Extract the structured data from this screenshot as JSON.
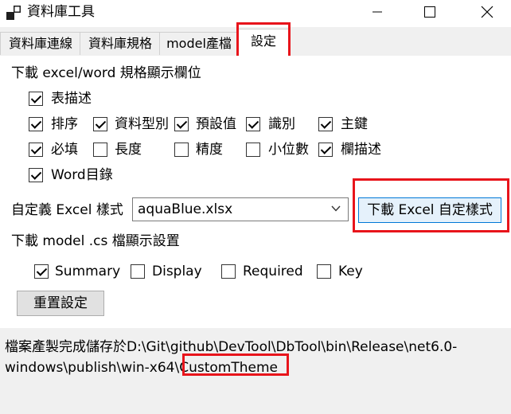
{
  "window": {
    "title": "資料庫工具",
    "icons": {
      "app": "app-window-icon",
      "minimize": "minimize-icon",
      "maximize": "maximize-icon",
      "close": "close-icon"
    }
  },
  "tabs": [
    {
      "label": "資料庫連線"
    },
    {
      "label": "資料庫規格"
    },
    {
      "label": "model產檔"
    },
    {
      "label": "設定"
    }
  ],
  "settings": {
    "excel_word_section_label": "下載 excel/word 規格顯示欄位",
    "checkboxes": [
      {
        "label": "表描述",
        "checked": true
      },
      {
        "label": "排序",
        "checked": true
      },
      {
        "label": "資料型別",
        "checked": true
      },
      {
        "label": "預設值",
        "checked": true
      },
      {
        "label": "識別",
        "checked": true
      },
      {
        "label": "主鍵",
        "checked": true
      },
      {
        "label": "必填",
        "checked": true
      },
      {
        "label": "長度",
        "checked": false
      },
      {
        "label": "精度",
        "checked": false
      },
      {
        "label": "小位數",
        "checked": false
      },
      {
        "label": "欄描述",
        "checked": true
      },
      {
        "label": "Word目錄",
        "checked": true
      }
    ],
    "custom_excel_style_label": "自定義 Excel 樣式",
    "excel_style_select_value": "aquaBlue.xlsx",
    "download_excel_style_button": "下載 Excel 自定樣式",
    "model_cs_section_label": "下載 model .cs 檔顯示設置",
    "model_checkboxes": [
      {
        "label": "Summary",
        "checked": true
      },
      {
        "label": "Display",
        "checked": false
      },
      {
        "label": "Required",
        "checked": false
      },
      {
        "label": "Key",
        "checked": false
      }
    ],
    "reset_button": "重置設定"
  },
  "status": {
    "message_prefix": "檔案產製完成儲存於D:\\Git\\github\\DevTool\\DbTool\\bin\\Release\\net6.0-windows\\publish\\win-x64\\",
    "message_highlight": "CustomTheme"
  },
  "colors": {
    "highlight": "#e8141b",
    "accent": "#0078d7"
  }
}
